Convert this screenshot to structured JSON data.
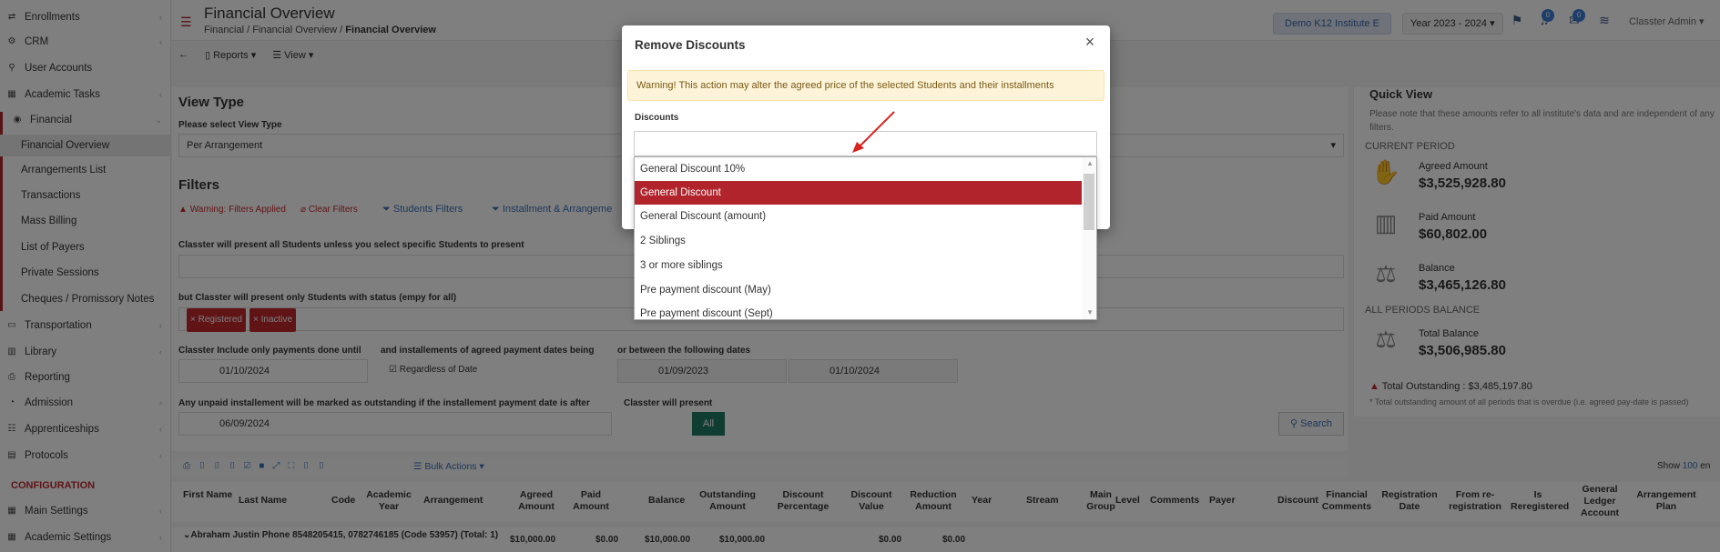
{
  "sidebar": {
    "items": [
      {
        "label": "Enrollments",
        "icon": "enrollments-icon"
      },
      {
        "label": "CRM",
        "icon": "crm-icon"
      },
      {
        "label": "User Accounts",
        "icon": "user-accounts-icon"
      },
      {
        "label": "Academic Tasks",
        "icon": "academic-tasks-icon"
      },
      {
        "label": "Financial",
        "icon": "financial-icon"
      }
    ],
    "financial_sub": [
      "Financial Overview",
      "Arrangements List",
      "Transactions",
      "Mass Billing",
      "List of Payers",
      "Private Sessions",
      "Cheques / Promissory Notes"
    ],
    "items2": [
      {
        "label": "Transportation",
        "icon": "transportation-icon"
      },
      {
        "label": "Library",
        "icon": "library-icon"
      },
      {
        "label": "Reporting",
        "icon": "reporting-icon"
      },
      {
        "label": "Admission",
        "icon": "admission-icon"
      },
      {
        "label": "Apprenticeships",
        "icon": "apprenticeships-icon"
      },
      {
        "label": "Protocols",
        "icon": "protocols-icon"
      }
    ],
    "config_label": "CONFIGURATION",
    "items3": [
      {
        "label": "Main Settings",
        "icon": "main-settings-icon"
      },
      {
        "label": "Academic Settings",
        "icon": "academic-settings-icon"
      }
    ]
  },
  "header": {
    "title": "Financial Overview",
    "crumb1": "Financial",
    "crumb2": "Financial Overview",
    "crumb3": "Financial Overview",
    "institute": "Demo K12 Institute E",
    "year": "Year 2023 - 2024",
    "notif_count": "0",
    "msg_count": "0",
    "user": "Classter Admin"
  },
  "subbar": {
    "reports": "Reports",
    "view": "View"
  },
  "view_type": {
    "title": "View Type",
    "label": "Please select View Type",
    "value": "Per Arrangement"
  },
  "filters": {
    "title": "Filters",
    "warning": "Warning: Filters Applied",
    "clear": "Clear Filters",
    "students": "Students Filters",
    "installments": "Installment & Arrangeme",
    "present_all": "Classter will present all Students unless you select specific Students to present",
    "status_label": "but Classter will present only Students with status (empy for all)",
    "tags": [
      "Registered",
      "Inactive"
    ],
    "payments_label": "Classter Include only payments done until",
    "payments_date": "01/10/2024",
    "installments_label": "and installements of agreed payment dates being",
    "regardless": "Regardless of Date",
    "between_label": "or between the following dates",
    "from_date": "01/09/2023",
    "to_date": "01/10/2024",
    "unpaid_label": "Any unpaid installement will be marked as outstanding if the installement payment date is after",
    "unpaid_date": "06/09/2024",
    "present_label": "Classter will present",
    "all_btn": "All",
    "search_btn": "Search"
  },
  "quick_view": {
    "title": "Quick View",
    "note": "Please note that these amounts refer to all institute's data and are independent of any filters.",
    "current": "CURRENT PERIOD",
    "agreed_label": "Agreed Amount",
    "agreed": "$3,525,928.80",
    "paid_label": "Paid Amount",
    "paid": "$60,802.00",
    "balance_label": "Balance",
    "balance": "$3,465,126.80",
    "all_periods": "ALL PERIODS BALANCE",
    "total_label": "Total Balance",
    "total": "$3,506,985.80",
    "outstanding": "Total Outstanding : $3,485,197.80",
    "foot": "* Total outstanding amount of all periods that is overdue (i.e. agreed pay-date is passed)"
  },
  "table": {
    "bulk": "Bulk Actions",
    "show": "Show",
    "show_n": "100",
    "show_suffix": "en",
    "headers": [
      "First Name",
      "Last Name",
      "Code",
      "Academic Year",
      "Arrangement",
      "Agreed Amount",
      "Paid Amount",
      "Balance",
      "Outstanding Amount",
      "Discount Percentage",
      "Discount Value",
      "Reduction Amount",
      "Year",
      "Stream",
      "Main Group",
      "Level",
      "Comments",
      "Payer",
      "Discount",
      "Financial Comments",
      "Registration Date",
      "From re-registration",
      "Is Reregistered",
      "General Ledger Account",
      "Arrangement Plan"
    ],
    "row_group": "Abraham Justin Phone 8548205415, 0782746185 (Code 53957) (Total: 1)",
    "row_vals": [
      "$10,000.00",
      "$0.00",
      "$10,000.00",
      "$10,000.00",
      "$0.00",
      "$0.00"
    ]
  },
  "modal": {
    "title": "Remove Discounts",
    "warning": "Warning! This action may alter the agreed price of the selected Students and their installments",
    "discounts_label": "Discounts",
    "options": [
      "General Discount 10%",
      "General Discount",
      "General Discount (amount)",
      "2 Siblings",
      "3 or more siblings",
      "Pre payment discount (May)",
      "Pre payment discount (Sept)"
    ],
    "selected_index": 1
  },
  "colors": {
    "brand": "#b2242c",
    "accent": "#3a6fb5",
    "teal": "#1f7a63"
  }
}
